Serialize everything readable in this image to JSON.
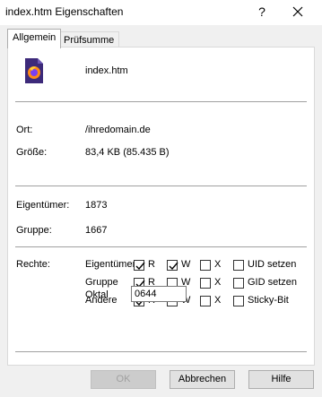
{
  "window": {
    "title": "index.htm Eigenschaften",
    "help_glyph": "?",
    "close_glyph": "✕"
  },
  "tabs": [
    {
      "label": "Allgemein"
    },
    {
      "label": "Prüfsumme"
    }
  ],
  "file": {
    "name": "index.htm",
    "icon": "firefox-html-file-icon"
  },
  "info": {
    "location_label": "Ort:",
    "location_value": "/ihredomain.de",
    "size_label": "Größe:",
    "size_value": "83,4 KB (85.435 B)",
    "owner_label": "Eigentümer:",
    "owner_value": "1873",
    "group_label": "Gruppe:",
    "group_value": "1667"
  },
  "permissions": {
    "label": "Rechte:",
    "rows": [
      {
        "label": "Eigentümer",
        "r": true,
        "w": true,
        "x": false,
        "special_label": "UID setzen",
        "special": false
      },
      {
        "label": "Gruppe",
        "r": true,
        "w": false,
        "x": false,
        "special_label": "GID setzen",
        "special": false
      },
      {
        "label": "Andere",
        "r": true,
        "w": false,
        "x": false,
        "special_label": "Sticky-Bit",
        "special": false
      }
    ],
    "r_label": "R",
    "w_label": "W",
    "x_label": "X",
    "octal_label": "Oktal",
    "octal_value": "0644"
  },
  "buttons": {
    "ok": "OK",
    "cancel": "Abbrechen",
    "help": "Hilfe"
  }
}
